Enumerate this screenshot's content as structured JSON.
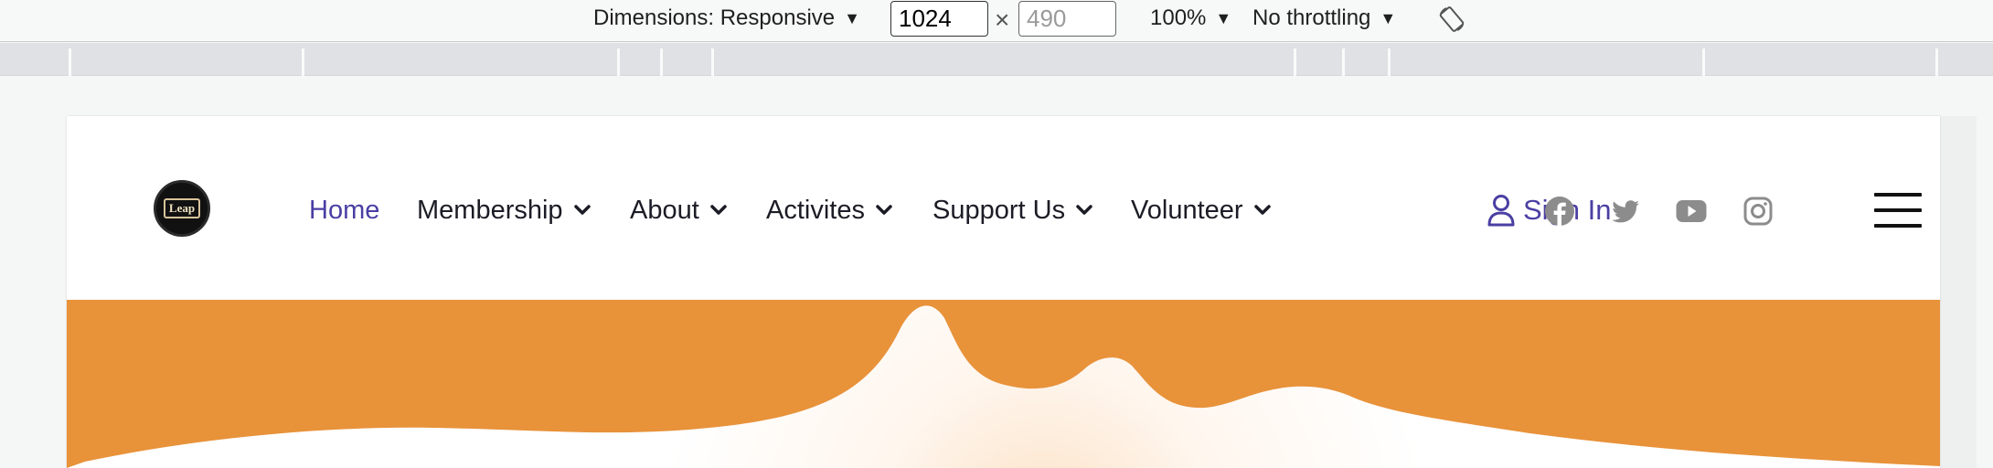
{
  "devtools": {
    "dimensions_label": "Dimensions: Responsive",
    "width_value": "1024",
    "height_placeholder": "490",
    "times": "×",
    "zoom": "100%",
    "throttling": "No throttling",
    "caret": "▼"
  },
  "site": {
    "logo_text": "Leap",
    "nav": [
      {
        "label": "Home",
        "active": true
      },
      {
        "label": "Membership",
        "dropdown": true
      },
      {
        "label": "About",
        "dropdown": true
      },
      {
        "label": "Activites",
        "dropdown": true
      },
      {
        "label": "Support Us",
        "dropdown": true
      },
      {
        "label": "Volunteer",
        "dropdown": true
      }
    ],
    "sign_in": "Sign In",
    "social_icons": [
      "facebook-icon",
      "twitter-icon",
      "youtube-icon",
      "instagram-icon"
    ],
    "colors": {
      "accent": "#4a3fa3",
      "hero": "#e8923a",
      "social": "#8c8c8c"
    }
  }
}
